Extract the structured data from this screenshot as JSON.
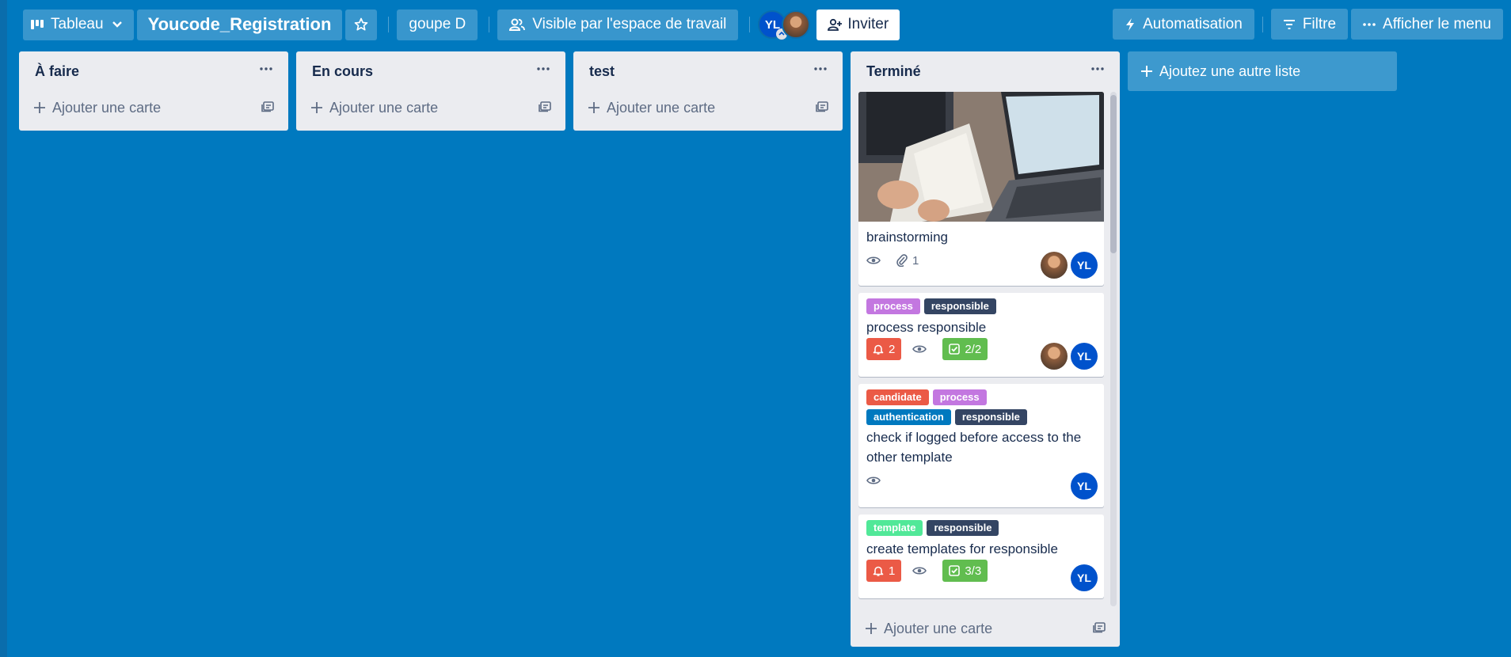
{
  "header": {
    "view_switch_label": "Tableau",
    "board_title": "Youcode_Registration",
    "workspace_label": "goupe D",
    "visibility_label": "Visible par l'espace de travail",
    "members": [
      {
        "initials": "YL",
        "type": "initials"
      },
      {
        "initials": "",
        "type": "photo"
      }
    ],
    "invite_label": "Inviter",
    "automation_label": "Automatisation",
    "filter_label": "Filtre",
    "menu_label": "Afficher le menu"
  },
  "lists": [
    {
      "title": "À faire",
      "add_card_label": "Ajouter une carte"
    },
    {
      "title": "En cours",
      "add_card_label": "Ajouter une carte"
    },
    {
      "title": "test",
      "add_card_label": "Ajouter une carte"
    },
    {
      "title": "Terminé",
      "add_card_label": "Ajouter une carte",
      "cards": [
        {
          "title": "brainstorming",
          "has_cover": true,
          "attachments": "1",
          "members": [
            "photo",
            "YL"
          ]
        },
        {
          "title": "process responsible",
          "labels": [
            {
              "text": "process",
              "color": "#c377e0"
            },
            {
              "text": "responsible",
              "color": "#344563"
            }
          ],
          "due_count": "2",
          "checklist": "2/2",
          "members": [
            "photo",
            "YL"
          ]
        },
        {
          "title": "check if logged before access to the other template",
          "labels": [
            {
              "text": "candidate",
              "color": "#eb5a46"
            },
            {
              "text": "process",
              "color": "#c377e0"
            },
            {
              "text": "authentication",
              "color": "#0079bf"
            },
            {
              "text": "responsible",
              "color": "#344563"
            }
          ],
          "members": [
            "YL"
          ]
        },
        {
          "title": "create templates for responsible",
          "labels": [
            {
              "text": "template",
              "color": "#51e898"
            },
            {
              "text": "responsible",
              "color": "#344563"
            }
          ],
          "due_count": "1",
          "checklist": "3/3",
          "members": [
            "YL"
          ]
        }
      ]
    }
  ],
  "add_list_label": "Ajoutez une autre liste",
  "colors": {
    "board_bg": "#0079bf",
    "list_bg": "#ebecf0",
    "due_red": "#eb5a46",
    "checklist_green": "#61bd4f",
    "avatar_blue": "#0052cc"
  }
}
